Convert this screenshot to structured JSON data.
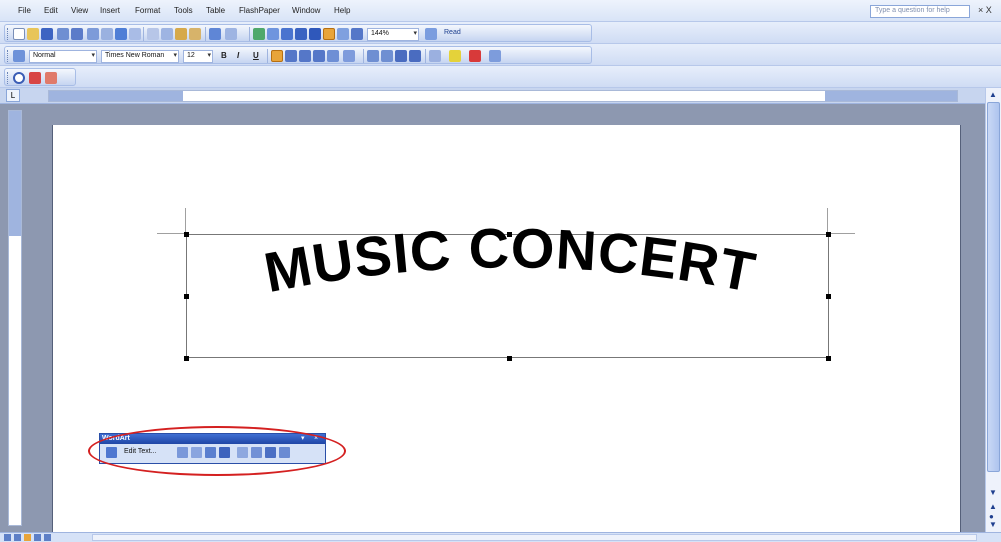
{
  "menu": {
    "items": [
      "File",
      "Edit",
      "View",
      "Insert",
      "Format",
      "Tools",
      "Table",
      "FlashPaper",
      "Window",
      "Help"
    ],
    "help_placeholder": "Type a question for help",
    "close_label": "× X"
  },
  "standard_toolbar": {
    "zoom": "144%",
    "read_label": "Read"
  },
  "formatting_toolbar": {
    "style": "Normal",
    "font": "Times New Roman",
    "size": "12",
    "bold": "B",
    "italic": "I",
    "underline": "U"
  },
  "document": {
    "wordart_text": "MUSIC CONCERT"
  },
  "wordart_toolbar": {
    "title": "WordArt",
    "edit_text_label": "Edit Text..."
  },
  "colors": {
    "toolbar_bg": "#d6e2f7",
    "titlebar": "#2a4fa8",
    "highlight_ellipse": "#d42020"
  }
}
